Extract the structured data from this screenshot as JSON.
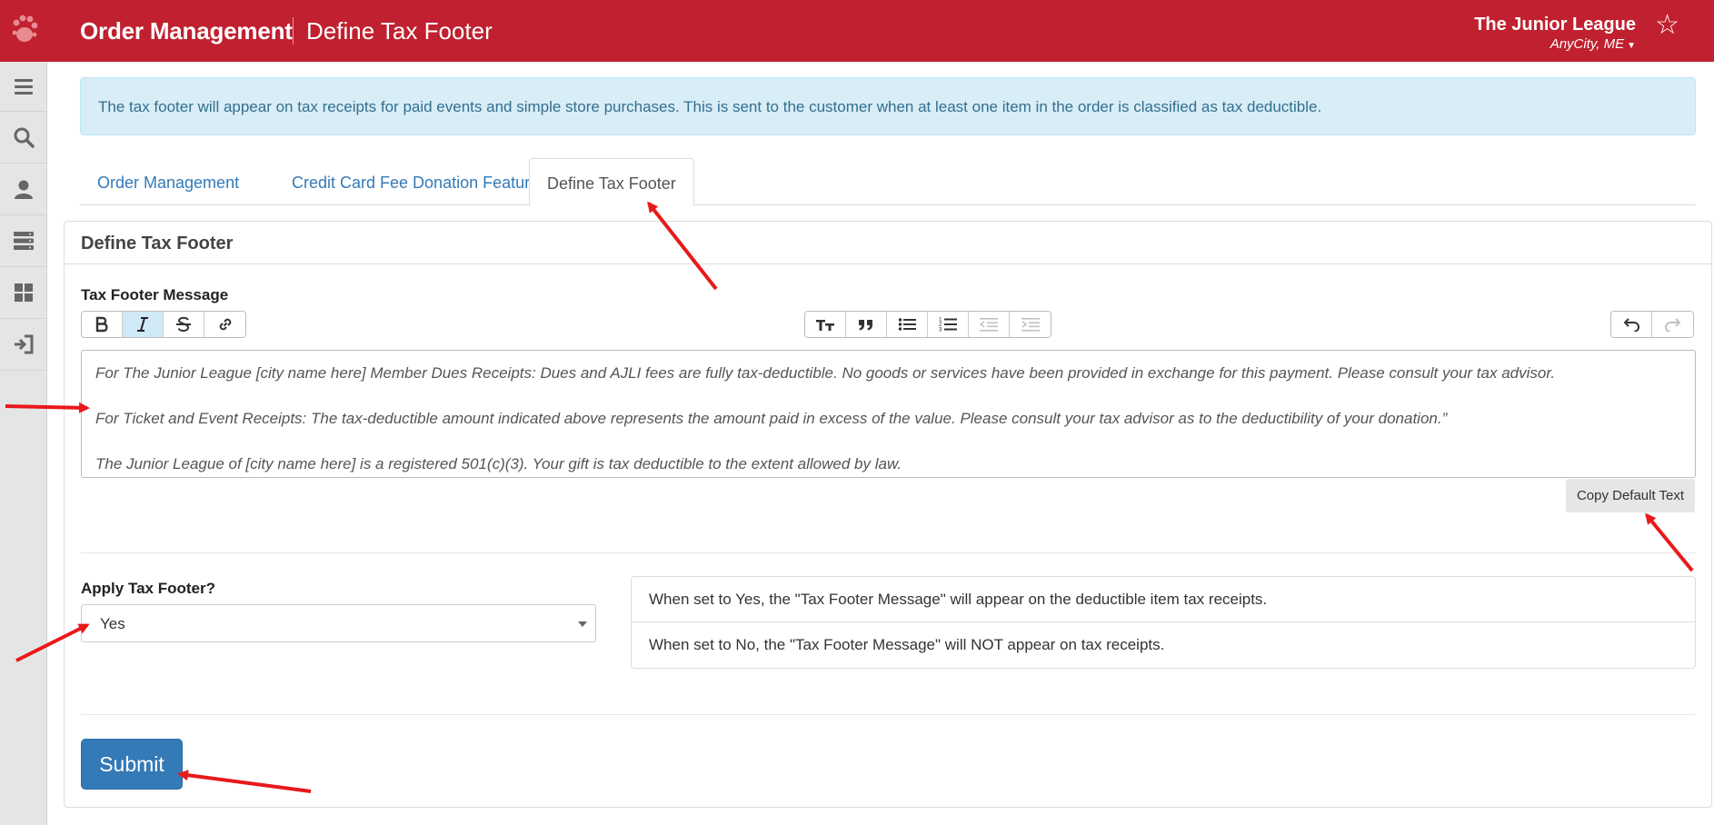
{
  "header": {
    "app_title": "Order Management",
    "page_title": "Define Tax Footer",
    "org_name": "The Junior League",
    "org_city": "AnyCity, ME",
    "logo_icon": "paw-logo",
    "favorite_icon": "star-outline-icon"
  },
  "sidebar": {
    "items": [
      {
        "icon": "menu-icon"
      },
      {
        "icon": "search-icon"
      },
      {
        "icon": "user-icon"
      },
      {
        "icon": "server-icon"
      },
      {
        "icon": "dashboard-icon"
      },
      {
        "icon": "sign-in-icon"
      }
    ]
  },
  "alert": {
    "text": "The tax footer will appear on tax receipts for paid events and simple store purchases. This is sent to the customer when at least one item in the order is classified as tax deductible."
  },
  "tabs": [
    {
      "label": "Order Management",
      "active": false
    },
    {
      "label": "Credit Card Fee Donation Feature",
      "active": false
    },
    {
      "label": "Define Tax Footer",
      "active": true
    }
  ],
  "panel": {
    "heading": "Define Tax Footer",
    "message_label": "Tax Footer Message",
    "editor_lines": [
      "For The Junior League [city name here] Member Dues Receipts: Dues and AJLI fees are fully tax-deductible. No goods or services have been provided in exchange for this payment. Please consult your tax advisor.",
      "For Ticket and Event Receipts: The tax-deductible amount indicated above represents the amount paid in excess of the value. Please consult your tax advisor as to the deductibility of your donation.”",
      "The Junior League of [city name here] is a registered 501(c)(3). Your gift is tax deductible to the extent allowed by law."
    ],
    "copy_default_label": "Copy Default Text",
    "apply_label": "Apply Tax Footer?",
    "apply_value": "Yes",
    "help_items": [
      "When set to Yes, the \"Tax Footer Message\" will appear on the deductible item tax receipts.",
      "When set to No, the \"Tax Footer Message\" will NOT appear on tax receipts."
    ],
    "submit_label": "Submit"
  },
  "colors": {
    "brand_red": "#c0202f",
    "link_blue": "#337ab7",
    "alert_bg": "#d9edf7",
    "annotation_arrow": "#e8191b"
  }
}
